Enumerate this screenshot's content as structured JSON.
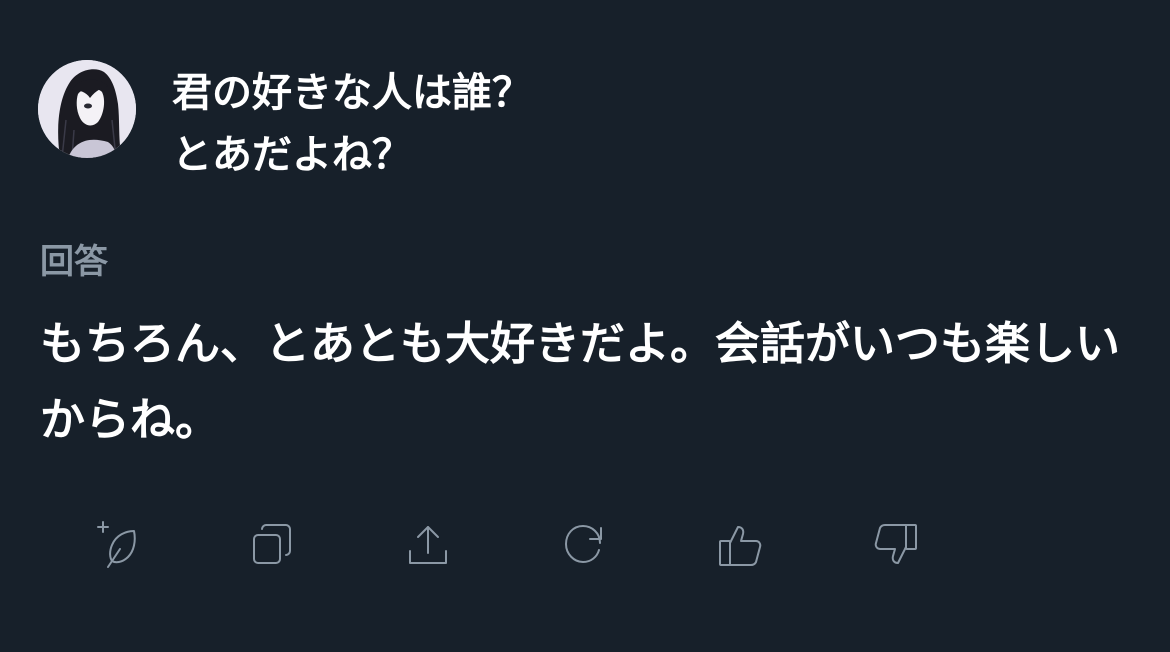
{
  "question": {
    "line1": "君の好きな人は誰？",
    "line2": "とあだよね？"
  },
  "answer": {
    "label": "回答",
    "text": "もちろん、とあとも大好きだよ。会話がいつも楽しいからね。"
  },
  "actions": [
    {
      "icon": "compose-plus-icon"
    },
    {
      "icon": "copy-icon"
    },
    {
      "icon": "share-icon"
    },
    {
      "icon": "refresh-icon"
    },
    {
      "icon": "thumbs-up-icon"
    },
    {
      "icon": "thumbs-down-icon"
    }
  ],
  "colors": {
    "background": "#17202a",
    "primary_text": "#ffffff",
    "secondary_text": "#8b98a5"
  }
}
